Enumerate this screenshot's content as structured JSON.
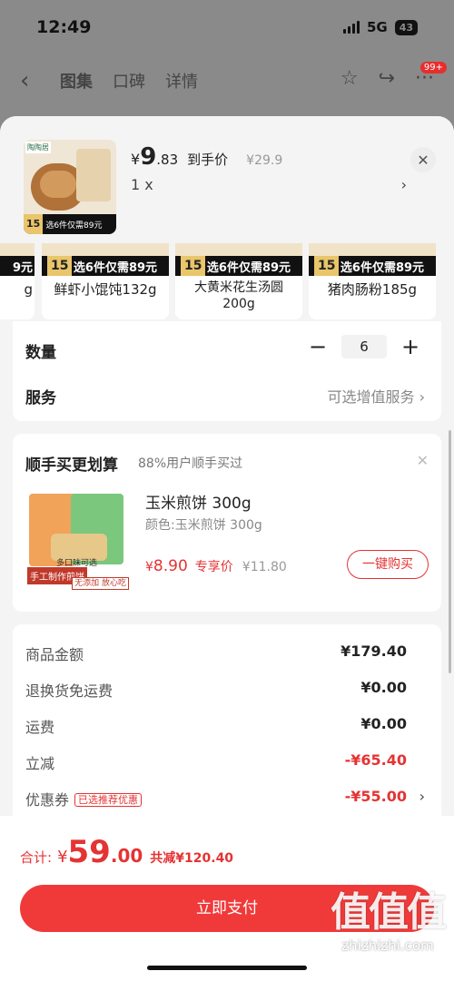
{
  "status_bar": {
    "time": "12:49",
    "network": "5G",
    "battery": "43"
  },
  "nav": {
    "tabs": [
      "图集",
      "口碑",
      "详情"
    ],
    "badge": "99+"
  },
  "product": {
    "brand": "陶陶居",
    "promo_num": "15",
    "promo_text": "选6件仅需89元",
    "price_yen": "¥",
    "price_int": "9",
    "price_dec": ".83",
    "price_label": "到手价",
    "price_orig": "¥29.9",
    "quantity_text": "1 x"
  },
  "variants": [
    {
      "name": "g",
      "promo_num": "",
      "promo_text": "9元"
    },
    {
      "name": "鲜虾小馄饨132g",
      "promo_num": "15",
      "promo_text": "选6件仅需89元"
    },
    {
      "name": "大黄米花生汤圆200g",
      "promo_num": "15",
      "promo_text": "选6件仅需89元"
    },
    {
      "name": "猪肉肠粉185g",
      "promo_num": "15",
      "promo_text": "选6件仅需89元"
    }
  ],
  "options": {
    "quantity_label": "数量",
    "quantity_value": "6",
    "minus": "−",
    "plus": "+",
    "service_label": "服务",
    "service_value": "可选增值服务"
  },
  "addon": {
    "title": "顺手买更划算",
    "subtitle": "88%用户顺手买过",
    "name": "玉米煎饼 300g",
    "color": "颜色:玉米煎饼 300g",
    "price_yen": "¥",
    "price": "8.90",
    "price_label": "专享价",
    "price_orig": "¥11.80",
    "buy_label": "一键购买",
    "img_tag1": "手工制作煎饼",
    "img_tag2": "无添加 放心吃",
    "img_tag3": "多口味可选"
  },
  "fees": [
    {
      "label": "商品金额",
      "amount": "¥179.40",
      "red": false
    },
    {
      "label": "退换货免运费",
      "amount": "¥0.00",
      "red": false
    },
    {
      "label": "运费",
      "amount": "¥0.00",
      "red": false
    },
    {
      "label": "立减",
      "amount": "-¥65.40",
      "red": true
    },
    {
      "label": "优惠券",
      "amount": "-¥55.00",
      "red": true,
      "tag": "已选推荐优惠"
    }
  ],
  "total": {
    "label": "合计:",
    "yen": "¥",
    "int": "59",
    "dec": ".00",
    "saved": "共减¥120.40"
  },
  "pay_button": "立即支付",
  "watermark": {
    "big": "值值值",
    "small": "zhizhizhi.com"
  },
  "colors": {
    "accent": "#f03a3a",
    "price_red": "#e53333"
  }
}
